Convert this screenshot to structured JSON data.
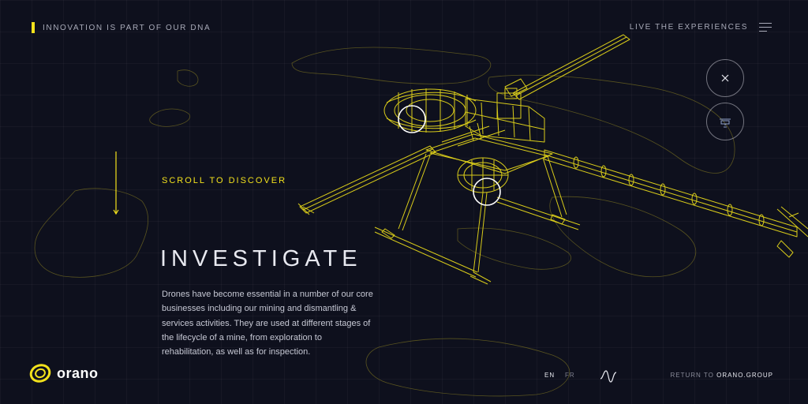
{
  "header": {
    "tagline": "INNOVATION IS PART OF OUR DNA",
    "live_label": "LIVE THE EXPERIENCES",
    "menu_icon": "hamburger-menu-icon"
  },
  "controls": {
    "close_icon": "close-icon",
    "drone_icon": "drone-icon"
  },
  "scroll": {
    "label": "SCROLL TO DISCOVER",
    "arrow_icon": "arrow-down-icon"
  },
  "content": {
    "title": "INVESTIGATE",
    "description": "Drones have become essential in a number of our core businesses including our mining and dismantling & services activities. They are used at different stages of the lifecycle of a mine, from exploration to rehabilitation, as well as for inspection."
  },
  "footer": {
    "logo_text": "orano",
    "lang_en": "EN",
    "lang_fr": "FR",
    "sound_icon": "sound-wave-icon",
    "return_prefix": "RETURN TO ",
    "return_accent": "ORANO.GROUP"
  },
  "colors": {
    "background": "#0e101d",
    "accent": "#f2e11c",
    "text": "#e8e9f0",
    "muted": "#a8aab8"
  }
}
